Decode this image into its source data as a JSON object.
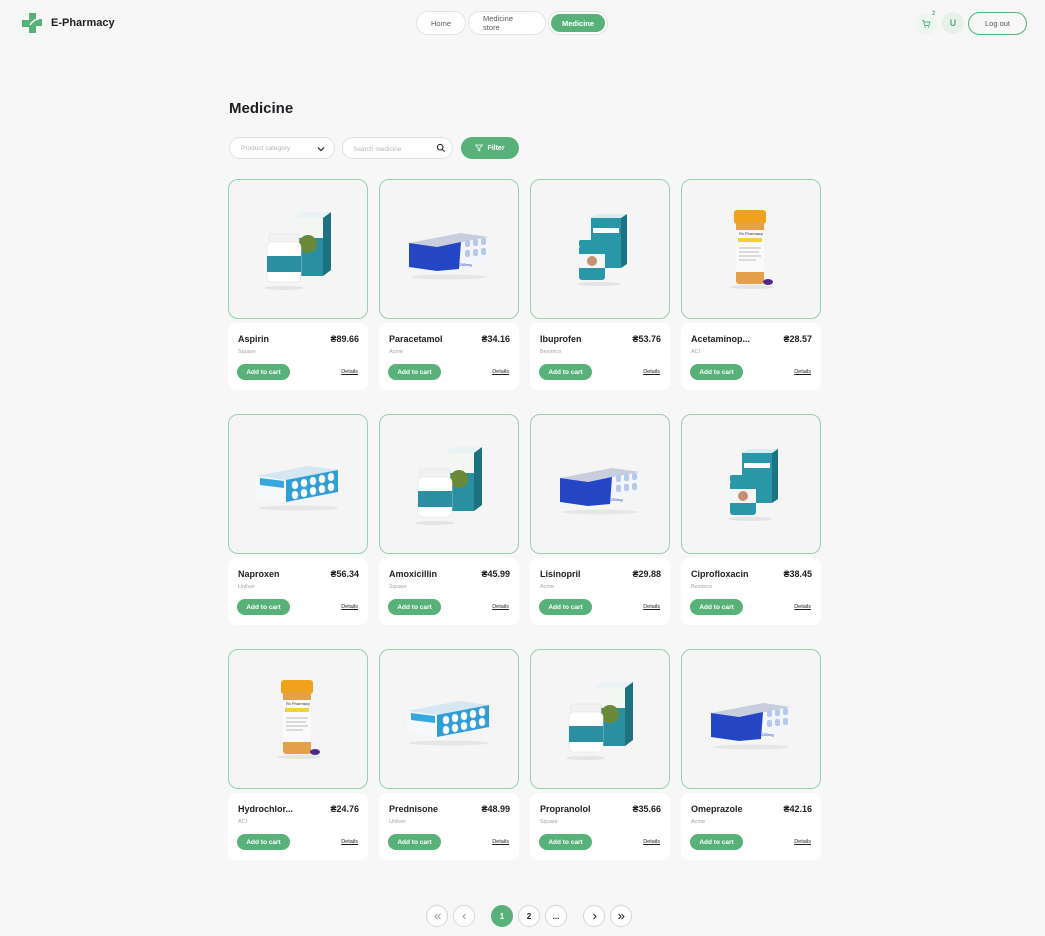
{
  "header": {
    "brand": "E-Pharmacy",
    "nav": [
      {
        "label": "Home"
      },
      {
        "label": "Medicine store"
      },
      {
        "label": "Medicine"
      }
    ],
    "cart_count": "2",
    "avatar_initial": "U",
    "logout_label": "Log out"
  },
  "page": {
    "title": "Medicine",
    "category_placeholder": "Product category",
    "search_placeholder": "Search medicine",
    "filter_label": "Filter"
  },
  "products": [
    {
      "name": "Aspirin",
      "price": "₴89.66",
      "brand": "Square",
      "image": "jar-box"
    },
    {
      "name": "Paracetamol",
      "price": "₴34.16",
      "brand": "Acme",
      "image": "blue-pack"
    },
    {
      "name": "Ibuprofen",
      "price": "₴53.76",
      "brand": "Beximco",
      "image": "teal-tub"
    },
    {
      "name": "Acetaminop...",
      "price": "₴28.57",
      "brand": "ACI",
      "image": "orange-bottle"
    },
    {
      "name": "Naproxen",
      "price": "₴56.34",
      "brand": "Unilver",
      "image": "white-blister"
    },
    {
      "name": "Amoxicillin",
      "price": "₴45.99",
      "brand": "Square",
      "image": "jar-box"
    },
    {
      "name": "Lisinopril",
      "price": "₴29.88",
      "brand": "Acme",
      "image": "blue-pack"
    },
    {
      "name": "Ciprofloxacin",
      "price": "₴38.45",
      "brand": "Beximco",
      "image": "teal-tub"
    },
    {
      "name": "Hydrochlor...",
      "price": "₴24.76",
      "brand": "ACI",
      "image": "orange-bottle"
    },
    {
      "name": "Prednisone",
      "price": "₴48.99",
      "brand": "Unilver",
      "image": "white-blister"
    },
    {
      "name": "Propranolol",
      "price": "₴35.66",
      "brand": "Square",
      "image": "jar-box"
    },
    {
      "name": "Omeprazole",
      "price": "₴42.16",
      "brand": "Acme",
      "image": "blue-pack"
    }
  ],
  "card_labels": {
    "add": "Add to cart",
    "details": "Details"
  },
  "pagination": {
    "pages": [
      "1",
      "2",
      "..."
    ],
    "current": "1",
    "first_icon": "double-chevron-left-icon",
    "prev_icon": "chevron-left-icon",
    "next_icon": "chevron-right-icon",
    "last_icon": "double-chevron-right-icon"
  },
  "colors": {
    "accent": "#59b17a",
    "border_light": "#93d3ad",
    "background": "#f7f7f7"
  }
}
